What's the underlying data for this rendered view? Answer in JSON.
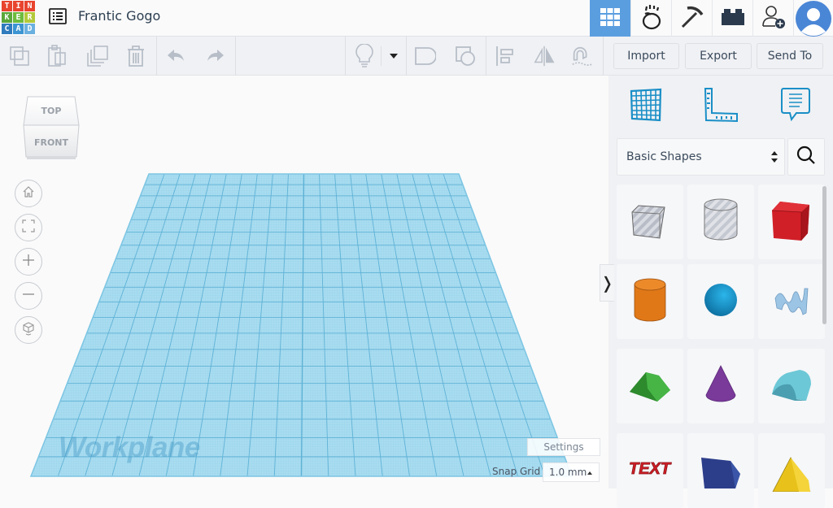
{
  "app": {
    "logo_letters": [
      "T",
      "I",
      "N",
      "K",
      "E",
      "R",
      "C",
      "A",
      "D"
    ],
    "logo_colors": [
      "#e8442e",
      "#e8442e",
      "#e8442e",
      "#5aa83a",
      "#6dbb3e",
      "#b4c93a",
      "#2f7bbd",
      "#3c94d2",
      "#6ab0e0"
    ],
    "design_title": "Frantic Gogo"
  },
  "topnav": {
    "items": [
      {
        "name": "3d-design",
        "icon": "grid-icon",
        "active": true
      },
      {
        "name": "codeblocks",
        "icon": "hand-icon",
        "active": false
      },
      {
        "name": "minecraft",
        "icon": "pickaxe-icon",
        "active": false
      },
      {
        "name": "lego",
        "icon": "brick-icon",
        "active": false
      },
      {
        "name": "invite",
        "icon": "add-user-icon",
        "active": false
      }
    ],
    "accent": "#5b9ee0"
  },
  "toolbar": {
    "left_icons": [
      "copy-icon",
      "paste-icon",
      "duplicate-icon",
      "delete-icon",
      "undo-icon",
      "redo-icon"
    ],
    "mid_icons": [
      "light-bulb-icon",
      "dropdown-caret-icon",
      "group-icon",
      "ungroup-icon",
      "align-icon",
      "mirror-icon",
      "cruise-icon"
    ],
    "import_label": "Import",
    "export_label": "Export",
    "sendto_label": "Send To"
  },
  "viewport": {
    "viewcube_top": "TOP",
    "viewcube_front": "FRONT",
    "nav_buttons": [
      "home-icon",
      "fit-view-icon",
      "zoom-in-icon",
      "zoom-out-icon",
      "ortho-view-icon"
    ],
    "workplane_label": "Workplane",
    "settings_label": "Settings",
    "snap_grid_label": "Snap Grid",
    "snap_grid_value": "1.0 mm",
    "panel_toggle_glyph": "❭"
  },
  "rightpanel": {
    "tabs": [
      "workplane-icon",
      "ruler-icon",
      "notes-icon"
    ],
    "category_value": "Basic Shapes",
    "shapes": [
      {
        "name": "box-hole",
        "color": "#b8bcc6"
      },
      {
        "name": "cylinder-hole",
        "color": "#c4c8d0"
      },
      {
        "name": "box",
        "color": "#d11f27"
      },
      {
        "name": "cylinder",
        "color": "#e07818"
      },
      {
        "name": "sphere",
        "color": "#1a9ad6"
      },
      {
        "name": "scribble",
        "color": "#9cc4e4"
      },
      {
        "name": "roof",
        "color": "#3aa63a"
      },
      {
        "name": "cone",
        "color": "#7a3a9a"
      },
      {
        "name": "round-roof",
        "color": "#5ab8c8"
      },
      {
        "name": "text",
        "color": "#d11f27"
      },
      {
        "name": "polygon",
        "color": "#2c3e8a"
      },
      {
        "name": "pyramid",
        "color": "#e8c21a"
      }
    ]
  }
}
